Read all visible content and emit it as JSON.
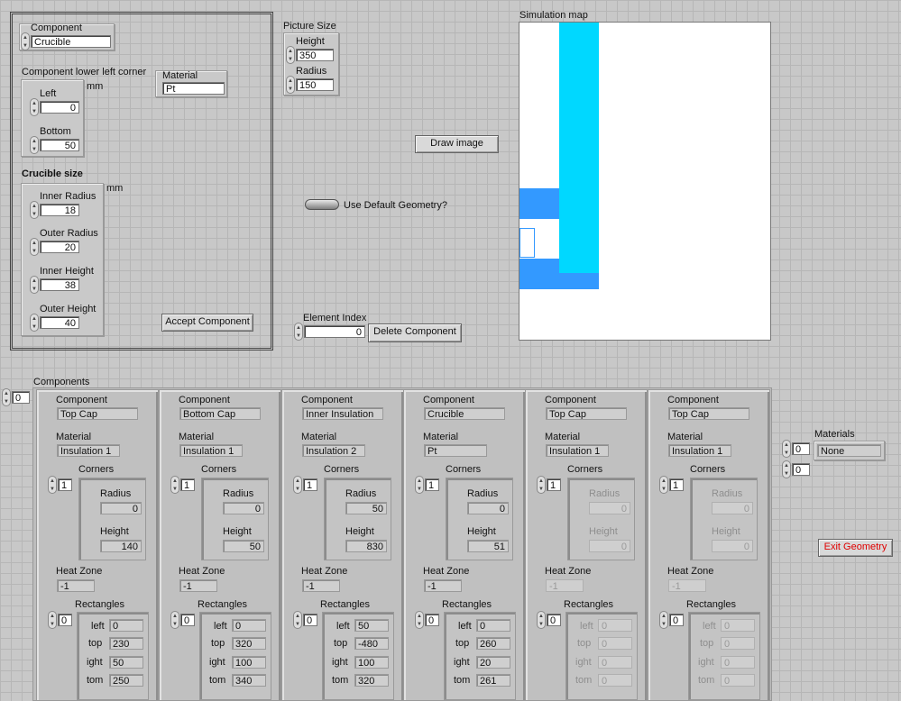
{
  "component_editor": {
    "component_label": "Component",
    "component_value": "Crucible",
    "lower_left_label": "Component lower left corner",
    "mm_label": "mm",
    "left_label": "Left",
    "left_value": "0",
    "bottom_label": "Bottom",
    "bottom_value": "50",
    "material_label": "Material",
    "material_value": "Pt",
    "crucible_size_label": "Crucible size",
    "mm2_label": "mm",
    "inner_radius_label": "Inner Radius",
    "inner_radius_value": "18",
    "outer_radius_label": "Outer Radius",
    "outer_radius_value": "20",
    "inner_height_label": "Inner Height",
    "inner_height_value": "38",
    "outer_height_label": "Outer Height",
    "outer_height_value": "40",
    "accept_button": "Accept Component"
  },
  "picture_size": {
    "title": "Picture Size",
    "height_label": "Height",
    "height_value": "350",
    "radius_label": "Radius",
    "radius_value": "150"
  },
  "draw_button": "Draw image",
  "default_geometry_label": "Use Default Geometry?",
  "element_index": {
    "label": "Element Index",
    "value": "0",
    "delete_button": "Delete Component"
  },
  "simulation_map": {
    "title": "Simulation map",
    "colors": {
      "cyan": "#00d8ff",
      "blue": "#3399ff"
    }
  },
  "components_section": {
    "title": "Components",
    "index_value": "0"
  },
  "materials": {
    "label": "Materials",
    "index_a": "0",
    "index_b": "0",
    "value": "None"
  },
  "exit_button": "Exit Geometry",
  "labels": {
    "component": "Component",
    "material": "Material",
    "corners": "Corners",
    "radius": "Radius",
    "height": "Height",
    "heat_zone": "Heat Zone",
    "rectangles": "Rectangles",
    "left": "left",
    "top": "top",
    "right": "ight",
    "bottom": "tom"
  },
  "cards": [
    {
      "component": "Top Cap",
      "material": "Insulation 1",
      "corners_index": "1",
      "radius": "0",
      "height": "140",
      "heat_zone": "-1",
      "rect_index": "0",
      "left": "0",
      "top": "230",
      "right": "50",
      "bottom": "250",
      "dimmed": false
    },
    {
      "component": "Bottom Cap",
      "material": "Insulation 1",
      "corners_index": "1",
      "radius": "0",
      "height": "50",
      "heat_zone": "-1",
      "rect_index": "0",
      "left": "0",
      "top": "320",
      "right": "100",
      "bottom": "340",
      "dimmed": false
    },
    {
      "component": "Inner Insulation",
      "material": "Insulation 2",
      "corners_index": "1",
      "radius": "50",
      "height": "830",
      "heat_zone": "-1",
      "rect_index": "0",
      "left": "50",
      "top": "-480",
      "right": "100",
      "bottom": "320",
      "dimmed": false
    },
    {
      "component": "Crucible",
      "material": "Pt",
      "corners_index": "1",
      "radius": "0",
      "height": "51",
      "heat_zone": "-1",
      "rect_index": "0",
      "left": "0",
      "top": "260",
      "right": "20",
      "bottom": "261",
      "dimmed": false
    },
    {
      "component": "Top Cap",
      "material": "Insulation 1",
      "corners_index": "1",
      "radius": "0",
      "height": "0",
      "heat_zone": "-1",
      "rect_index": "0",
      "left": "0",
      "top": "0",
      "right": "0",
      "bottom": "0",
      "dimmed": true
    },
    {
      "component": "Top Cap",
      "material": "Insulation 1",
      "corners_index": "1",
      "radius": "0",
      "height": "0",
      "heat_zone": "-1",
      "rect_index": "0",
      "left": "0",
      "top": "0",
      "right": "0",
      "bottom": "0",
      "dimmed": true
    }
  ]
}
